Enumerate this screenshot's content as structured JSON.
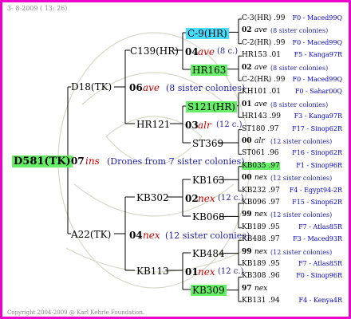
{
  "header": {
    "date": "3- 8-2009 ( 13: 26)"
  },
  "footer": {
    "copyright": "Copyright 2004-2009 @ Karl Kehrle Foundation."
  },
  "root": {
    "id": "D581(TK)",
    "num": "07",
    "note": "ins",
    "desc": "(Drones from 7 sister colonies)"
  },
  "gen1": [
    {
      "id": "D18(TK)",
      "num": "06",
      "note": "ave",
      "desc": "(8 sister colonies)"
    },
    {
      "id": "A22(TK)",
      "num": "04",
      "note": "nex",
      "desc": "(12 sister colonies)"
    }
  ],
  "gen2": [
    {
      "id": "C139(HR)",
      "num": "04",
      "note": "ave",
      "desc": "(8 c.)"
    },
    {
      "id": "HR121",
      "num": "03",
      "note": "alr",
      "desc": "(12 c.)"
    },
    {
      "id": "KB302",
      "num": "02",
      "note": "nex",
      "desc": "(12 c.)"
    },
    {
      "id": "KB113",
      "num": "01",
      "note": "nex",
      "desc": "(12 c.)"
    }
  ],
  "gen3": [
    {
      "id": "C-9(HR)"
    },
    {
      "id": "HR163"
    },
    {
      "id": "S121(HR)"
    },
    {
      "id": "ST369"
    },
    {
      "id": "KB163"
    },
    {
      "id": "KB068"
    },
    {
      "id": "KB484"
    },
    {
      "id": "KB309"
    }
  ],
  "leaves": [
    {
      "text": "C-3(HR) .99",
      "ref": "F0 - Maced99Q"
    },
    {
      "num": "02",
      "note": "ave",
      "desc": "(8 sister colonies)"
    },
    {
      "text": "C-2(HR) .99",
      "ref": "F0 - Maced99Q"
    },
    {
      "text": "HR153 .01",
      "ref": "F5 - Kanga97R"
    },
    {
      "num": "02",
      "note": "ave",
      "desc": "(8 sister colonies)"
    },
    {
      "text": "C-2(HR) .99",
      "ref": "F0 - Maced99Q"
    },
    {
      "text": "KH101 .01",
      "ref": "F0 - Sahar00Q"
    },
    {
      "num": "01",
      "note": "ave",
      "desc": "(8 sister colonies)"
    },
    {
      "text": "HR143 .99",
      "ref": "F3 - Kanga97R"
    },
    {
      "text": "ST180 .97",
      "ref": "F17 - Sinop62R"
    },
    {
      "num": "00",
      "note": "alr",
      "desc": "(12 sister colonies)"
    },
    {
      "text": "ST061 .96",
      "ref": "F16 - Sinop62R"
    },
    {
      "text": "KB035 .97",
      "ref": "F1 - Sinop96R"
    },
    {
      "num": "00",
      "note": "nex",
      "desc": "(12 sister colonies)"
    },
    {
      "text": "KB232 .97",
      "ref": "F4 - Egypt94-2R"
    },
    {
      "text": "KB096 .97",
      "ref": "F15 - Sinop62R"
    },
    {
      "num": "99",
      "note": "nex",
      "desc": "(12 sister colonies)"
    },
    {
      "text": "KB189 .95",
      "ref": "F7 - Atlas85R"
    },
    {
      "text": "KB488 .97",
      "ref": "F3 - Maced93R"
    },
    {
      "num": "99",
      "note": "nex",
      "desc": "(12 sister colonies)"
    },
    {
      "text": "KB189 .95",
      "ref": "F7 - Atlas85R"
    },
    {
      "text": "KB308 .96",
      "ref": "F0 - Sinop96R"
    },
    {
      "num": "97",
      "note": "nex",
      "desc": ""
    },
    {
      "text": "KB131 .94",
      "ref": "F4 - Kenya4R"
    }
  ]
}
